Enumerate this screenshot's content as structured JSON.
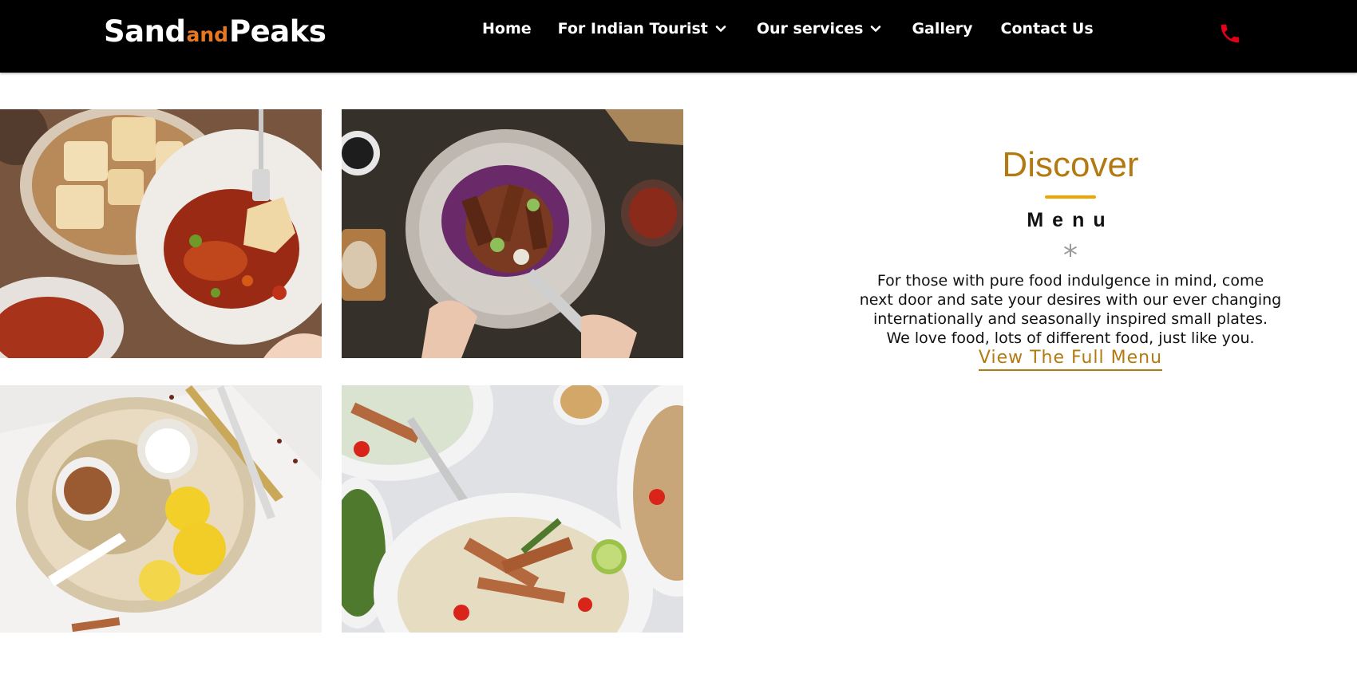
{
  "logo": {
    "part1": "Sand",
    "part2": "and",
    "part3": "Peaks"
  },
  "nav": {
    "items": [
      {
        "label": "Home",
        "dropdown": false
      },
      {
        "label": "For Indian Tourist",
        "dropdown": true
      },
      {
        "label": "Our services",
        "dropdown": true
      },
      {
        "label": "Gallery",
        "dropdown": false
      },
      {
        "label": "Contact Us",
        "dropdown": false
      }
    ]
  },
  "menu_section": {
    "heading": "Discover",
    "subheading": "Menu",
    "separator": "*",
    "description": [
      "For those with pure food indulgence in mind, come",
      "next door and sate your desires with our ever changing",
      "internationally and seasonally inspired small plates.",
      "We love food, lots of different food, just like you."
    ],
    "link": "View The Full Menu"
  },
  "colors": {
    "navbar_bg": "#000000",
    "logo_accent": "#e87722",
    "phone_icon": "#e3001b",
    "heading": "#b27a10",
    "heading_underline": "#f0a500",
    "link": "#b27a10"
  },
  "icons": {
    "phone": "phone-icon",
    "dropdown": "chevron-down-icon"
  }
}
